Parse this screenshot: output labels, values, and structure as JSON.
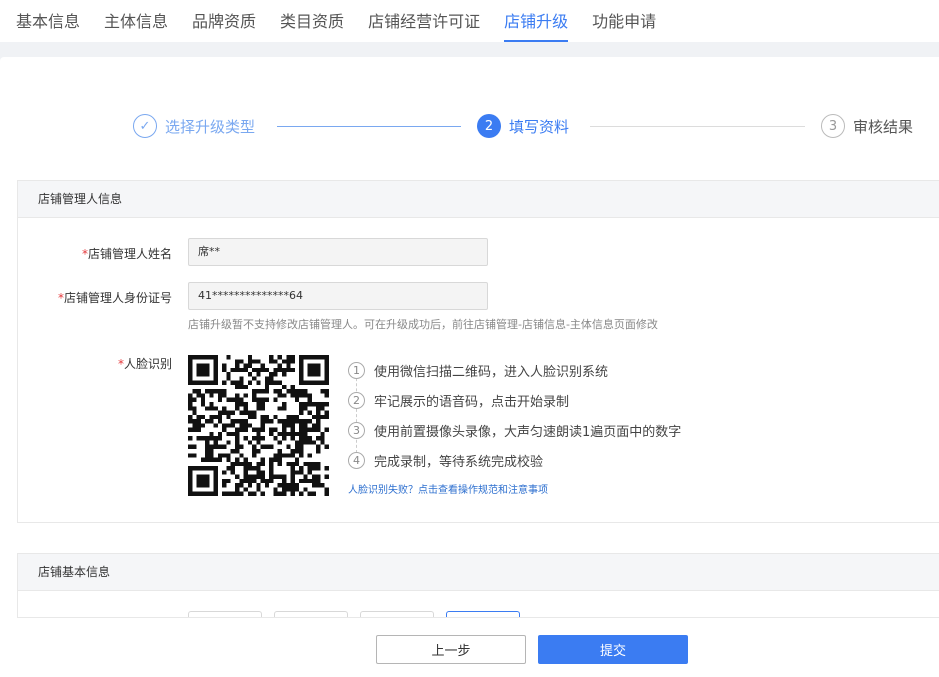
{
  "tabs": [
    {
      "label": "基本信息"
    },
    {
      "label": "主体信息"
    },
    {
      "label": "品牌资质"
    },
    {
      "label": "类目资质"
    },
    {
      "label": "店铺经营许可证"
    },
    {
      "label": "店铺升级",
      "active": true
    },
    {
      "label": "功能申请"
    }
  ],
  "steps": [
    {
      "num": "✓",
      "label": "选择升级类型",
      "state": "done"
    },
    {
      "num": "2",
      "label": "填写资料",
      "state": "current"
    },
    {
      "num": "3",
      "label": "审核结果",
      "state": "pending"
    }
  ],
  "manager_section": {
    "title": "店铺管理人信息",
    "name_label": "店铺管理人姓名",
    "name_value": "席**",
    "id_label": "店铺管理人身份证号",
    "id_value": "41**************64",
    "id_hint": "店铺升级暂不支持修改店铺管理人。可在升级成功后，前往店铺管理-店铺信息-主体信息页面修改",
    "face_label": "人脸识别",
    "face_steps": [
      {
        "num": "1",
        "text": "使用微信扫描二维码，进入人脸识别系统"
      },
      {
        "num": "2",
        "text": "牢记展示的语音码，点击开始录制"
      },
      {
        "num": "3",
        "text": "使用前置摄像头录像，大声匀速朗读1遍页面中的数字"
      },
      {
        "num": "4",
        "text": "完成录制，等待系统完成校验"
      }
    ],
    "face_help_link": "人脸识别失败？点击查看操作规范和注意事项"
  },
  "basic_section": {
    "title": "店铺基本信息"
  },
  "footer": {
    "prev_label": "上一步",
    "submit_label": "提交"
  },
  "colors": {
    "accent": "#3b7cf2",
    "required": "#e4393c"
  }
}
